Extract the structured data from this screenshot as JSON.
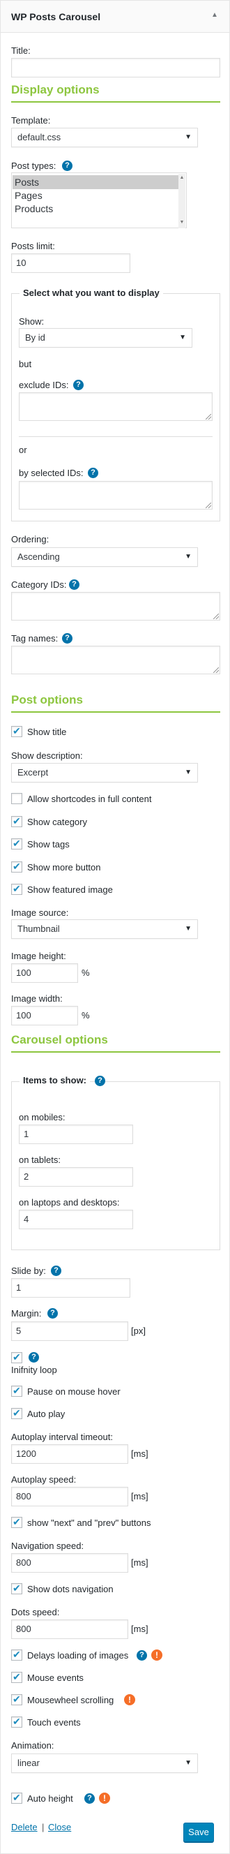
{
  "widget": {
    "title": "WP Posts Carousel"
  },
  "general": {
    "title_label": "Title:",
    "title_value": ""
  },
  "display": {
    "heading": "Display options",
    "template_label": "Template:",
    "template_value": "default.css",
    "post_types_label": "Post types:",
    "post_types": [
      "Posts",
      "Pages",
      "Products"
    ],
    "post_types_selected": "Posts",
    "posts_limit_label": "Posts limit:",
    "posts_limit_value": "10",
    "select_legend": "Select what you want to display",
    "show_label": "Show:",
    "show_value": "By id",
    "but_label": "but",
    "exclude_ids_label": "exclude IDs:",
    "or_label": "or",
    "by_selected_ids_label": "by selected IDs:",
    "ordering_label": "Ordering:",
    "ordering_value": "Ascending",
    "category_ids_label": "Category IDs:",
    "tag_names_label": "Tag names:"
  },
  "post": {
    "heading": "Post options",
    "show_title": "Show title",
    "show_description_label": "Show description:",
    "show_description_value": "Excerpt",
    "allow_shortcodes": "Allow shortcodes in full content",
    "show_category": "Show category",
    "show_tags": "Show tags",
    "show_more_button": "Show more button",
    "show_featured_image": "Show featured image",
    "image_source_label": "Image source:",
    "image_source_value": "Thumbnail",
    "image_height_label": "Image height:",
    "image_height_value": "100",
    "image_width_label": "Image width:",
    "image_width_value": "100",
    "percent_unit": "%"
  },
  "carousel": {
    "heading": "Carousel options",
    "items_legend": "Items to show:",
    "mobiles_label": "on mobiles:",
    "mobiles_value": "1",
    "tablets_label": "on tablets:",
    "tablets_value": "2",
    "laptops_label": "on laptops and desktops:",
    "laptops_value": "4",
    "slide_by_label": "Slide by:",
    "slide_by_value": "1",
    "margin_label": "Margin:",
    "margin_value": "5",
    "px_unit": "[px]",
    "infinity_loop": "Inifnity loop",
    "pause_on_hover": "Pause on mouse hover",
    "auto_play": "Auto play",
    "autoplay_timeout_label": "Autoplay interval timeout:",
    "autoplay_timeout_value": "1200",
    "ms_unit": "[ms]",
    "autoplay_speed_label": "Autoplay speed:",
    "autoplay_speed_value": "800",
    "show_nav_buttons": "show \"next\" and \"prev\" buttons",
    "navigation_speed_label": "Navigation speed:",
    "navigation_speed_value": "800",
    "show_dots": "Show dots navigation",
    "dots_speed_label": "Dots speed:",
    "dots_speed_value": "800",
    "delays_loading": "Delays loading of images",
    "mouse_events": "Mouse events",
    "mousewheel_scrolling": "Mousewheel scrolling",
    "touch_events": "Touch events",
    "animation_label": "Animation:",
    "animation_value": "linear",
    "auto_height": "Auto height"
  },
  "footer": {
    "delete_label": "Delete",
    "separator": "|",
    "close_label": "Close",
    "save_label": "Save"
  },
  "icons": {
    "help": "question-mark-icon",
    "warning": "exclamation-icon",
    "checkmark": "check-icon"
  },
  "colors": {
    "accent": "#8dc63f",
    "primary": "#0085ba",
    "link": "#0073aa",
    "help": "#0073aa",
    "warning": "#f56e28"
  }
}
